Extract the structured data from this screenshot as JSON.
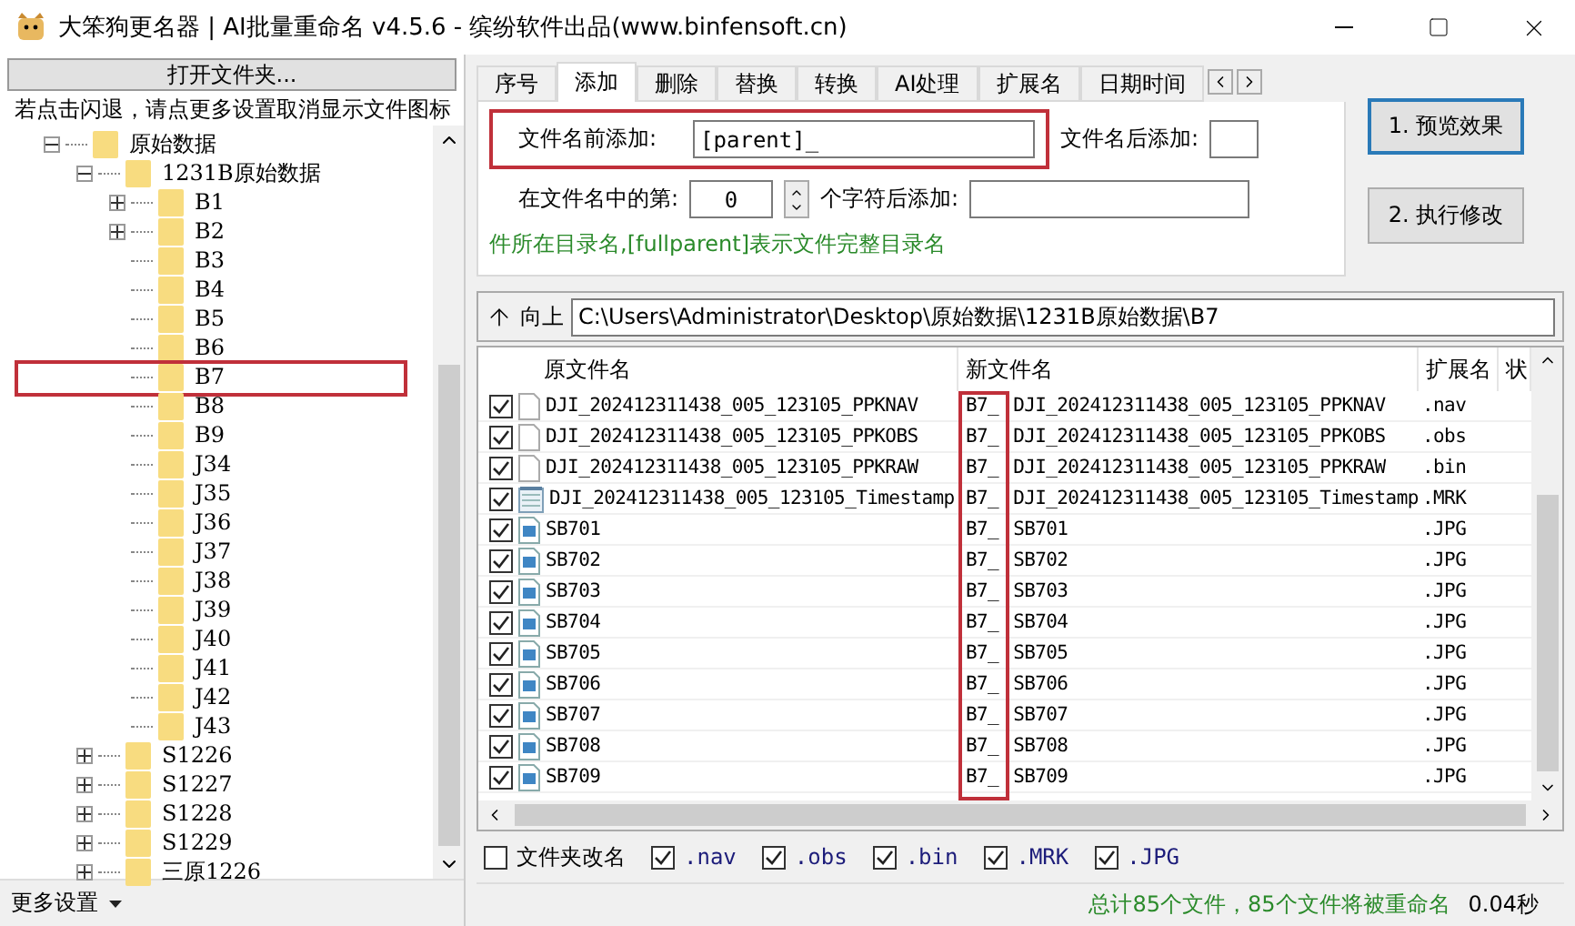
{
  "window": {
    "title": "大笨狗更名器 | AI批量重命名 v4.5.6 - 缤纷软件出品(www.binfensoft.cn)"
  },
  "left": {
    "open_button": "打开文件夹...",
    "hint": "若点击闪退，请点更多设置取消显示文件图标",
    "tree": [
      {
        "label": "原始数据",
        "has_children": true,
        "expanded": true,
        "marked": false,
        "children": [
          {
            "label": "1231B原始数据",
            "has_children": true,
            "expanded": true,
            "marked": false,
            "children": [
              {
                "label": "B1",
                "has_children": true,
                "expanded": false,
                "marked": false
              },
              {
                "label": "B2",
                "has_children": true,
                "expanded": false,
                "marked": false
              },
              {
                "label": "B3",
                "has_children": false,
                "expanded": false,
                "marked": false
              },
              {
                "label": "B4",
                "has_children": false,
                "expanded": false,
                "marked": false
              },
              {
                "label": "B5",
                "has_children": false,
                "expanded": false,
                "marked": false
              },
              {
                "label": "B6",
                "has_children": false,
                "expanded": false,
                "marked": false
              },
              {
                "label": "B7",
                "has_children": false,
                "expanded": false,
                "marked": true
              },
              {
                "label": "B8",
                "has_children": false,
                "expanded": false,
                "marked": false
              },
              {
                "label": "B9",
                "has_children": false,
                "expanded": false,
                "marked": false
              },
              {
                "label": "J34",
                "has_children": false,
                "expanded": false,
                "marked": false
              },
              {
                "label": "J35",
                "has_children": false,
                "expanded": false,
                "marked": false
              },
              {
                "label": "J36",
                "has_children": false,
                "expanded": false,
                "marked": false
              },
              {
                "label": "J37",
                "has_children": false,
                "expanded": false,
                "marked": false
              },
              {
                "label": "J38",
                "has_children": false,
                "expanded": false,
                "marked": false
              },
              {
                "label": "J39",
                "has_children": false,
                "expanded": false,
                "marked": false
              },
              {
                "label": "J40",
                "has_children": false,
                "expanded": false,
                "marked": false
              },
              {
                "label": "J41",
                "has_children": false,
                "expanded": false,
                "marked": false
              },
              {
                "label": "J42",
                "has_children": false,
                "expanded": false,
                "marked": false
              },
              {
                "label": "J43",
                "has_children": false,
                "expanded": false,
                "marked": false
              }
            ]
          },
          {
            "label": "S1226",
            "has_children": true,
            "expanded": false,
            "marked": false
          },
          {
            "label": "S1227",
            "has_children": true,
            "expanded": false,
            "marked": false
          },
          {
            "label": "S1228",
            "has_children": true,
            "expanded": false,
            "marked": false
          },
          {
            "label": "S1229",
            "has_children": true,
            "expanded": false,
            "marked": false
          },
          {
            "label": "三原1226",
            "has_children": true,
            "expanded": false,
            "marked": false
          }
        ]
      }
    ],
    "more_settings": "更多设置"
  },
  "tabs": [
    {
      "label": "序号",
      "selected": false
    },
    {
      "label": "添加",
      "selected": true
    },
    {
      "label": "删除",
      "selected": false
    },
    {
      "label": "替换",
      "selected": false
    },
    {
      "label": "转换",
      "selected": false
    },
    {
      "label": "AI处理",
      "selected": false
    },
    {
      "label": "扩展名",
      "selected": false
    },
    {
      "label": "日期时间",
      "selected": false
    }
  ],
  "add_panel": {
    "prefix_label": "文件名前添加:",
    "prefix_value": "[parent]_",
    "prefix_marked": true,
    "suffix_label": "文件名后添加:",
    "position_label": "在文件名中的第:",
    "position_value": "0",
    "after_label": "个字符后添加:",
    "help": "件所在目录名,[fullparent]表示文件完整目录名"
  },
  "buttons": [
    "1. 预览效果",
    "2. 执行修改"
  ],
  "path_bar": {
    "up_label": "向上",
    "path": "C:\\Users\\Administrator\\Desktop\\原始数据\\1231B原始数据\\B7"
  },
  "table": {
    "columns": [
      "原文件名",
      "新文件名",
      "扩展名",
      "状"
    ],
    "prefix_marked": true,
    "rows": [
      {
        "checked": true,
        "kind": "file",
        "original": "DJI_202412311438_005_123105_PPKNAV",
        "prefix": "B7_",
        "new": "DJI_202412311438_005_123105_PPKNAV",
        "ext": ".nav"
      },
      {
        "checked": true,
        "kind": "file",
        "original": "DJI_202412311438_005_123105_PPKOBS",
        "prefix": "B7_",
        "new": "DJI_202412311438_005_123105_PPKOBS",
        "ext": ".obs"
      },
      {
        "checked": true,
        "kind": "file",
        "original": "DJI_202412311438_005_123105_PPKRAW",
        "prefix": "B7_",
        "new": "DJI_202412311438_005_123105_PPKRAW",
        "ext": ".bin"
      },
      {
        "checked": true,
        "kind": "text",
        "original": "DJI_202412311438_005_123105_Timestamp",
        "prefix": "B7_",
        "new": "DJI_202412311438_005_123105_Timestamp",
        "ext": ".MRK"
      },
      {
        "checked": true,
        "kind": "image",
        "original": "SB701",
        "prefix": "B7_",
        "new": "SB701",
        "ext": ".JPG"
      },
      {
        "checked": true,
        "kind": "image",
        "original": "SB702",
        "prefix": "B7_",
        "new": "SB702",
        "ext": ".JPG"
      },
      {
        "checked": true,
        "kind": "image",
        "original": "SB703",
        "prefix": "B7_",
        "new": "SB703",
        "ext": ".JPG"
      },
      {
        "checked": true,
        "kind": "image",
        "original": "SB704",
        "prefix": "B7_",
        "new": "SB704",
        "ext": ".JPG"
      },
      {
        "checked": true,
        "kind": "image",
        "original": "SB705",
        "prefix": "B7_",
        "new": "SB705",
        "ext": ".JPG"
      },
      {
        "checked": true,
        "kind": "image",
        "original": "SB706",
        "prefix": "B7_",
        "new": "SB706",
        "ext": ".JPG"
      },
      {
        "checked": true,
        "kind": "image",
        "original": "SB707",
        "prefix": "B7_",
        "new": "SB707",
        "ext": ".JPG"
      },
      {
        "checked": true,
        "kind": "image",
        "original": "SB708",
        "prefix": "B7_",
        "new": "SB708",
        "ext": ".JPG"
      },
      {
        "checked": true,
        "kind": "image",
        "original": "SB709",
        "prefix": "B7_",
        "new": "SB709",
        "ext": ".JPG"
      }
    ]
  },
  "filters": [
    {
      "label": "文件夹改名",
      "checked": false,
      "kind": "folder"
    },
    {
      "label": ".nav",
      "checked": true,
      "kind": "ext"
    },
    {
      "label": ".obs",
      "checked": true,
      "kind": "ext"
    },
    {
      "label": ".bin",
      "checked": true,
      "kind": "ext"
    },
    {
      "label": ".MRK",
      "checked": true,
      "kind": "ext"
    },
    {
      "label": ".JPG",
      "checked": true,
      "kind": "ext"
    }
  ],
  "status": {
    "summary": "总计85个文件，85个文件将被重命名",
    "time": "0.04秒"
  }
}
